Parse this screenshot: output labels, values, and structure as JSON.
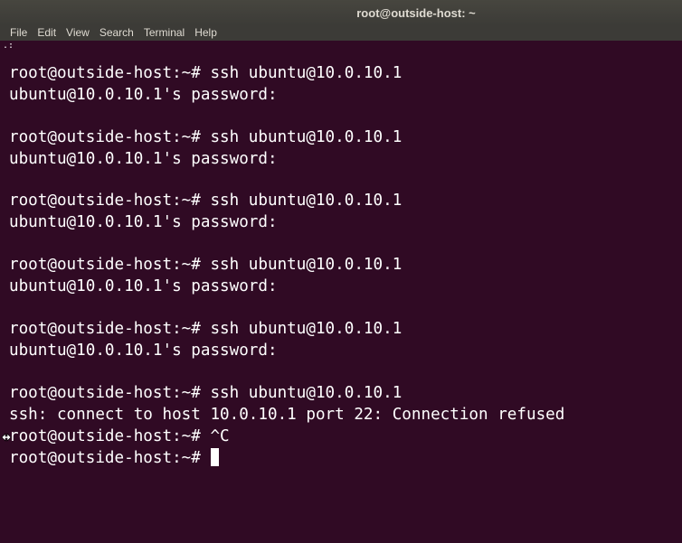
{
  "window": {
    "title": "root@outside-host: ~"
  },
  "menu": {
    "items": [
      "File",
      "Edit",
      "View",
      "Search",
      "Terminal",
      "Help"
    ]
  },
  "terminal": {
    "residue": ".:",
    "lines": [
      "root@outside-host:~# ssh ubuntu@10.0.10.1",
      "ubuntu@10.0.10.1's password:",
      "root@outside-host:~# ssh ubuntu@10.0.10.1",
      "ubuntu@10.0.10.1's password:",
      "root@outside-host:~# ssh ubuntu@10.0.10.1",
      "ubuntu@10.0.10.1's password:",
      "root@outside-host:~# ssh ubuntu@10.0.10.1",
      "ubuntu@10.0.10.1's password:",
      "root@outside-host:~# ssh ubuntu@10.0.10.1",
      "ubuntu@10.0.10.1's password:",
      "root@outside-host:~# ssh ubuntu@10.0.10.1",
      "ssh: connect to host 10.0.10.1 port 22: Connection refused",
      "root@outside-host:~# ^C",
      "root@outside-host:~# "
    ]
  },
  "colors": {
    "background": "#300a24",
    "titlebar": "#3c3b37",
    "text": "#ffffff"
  }
}
